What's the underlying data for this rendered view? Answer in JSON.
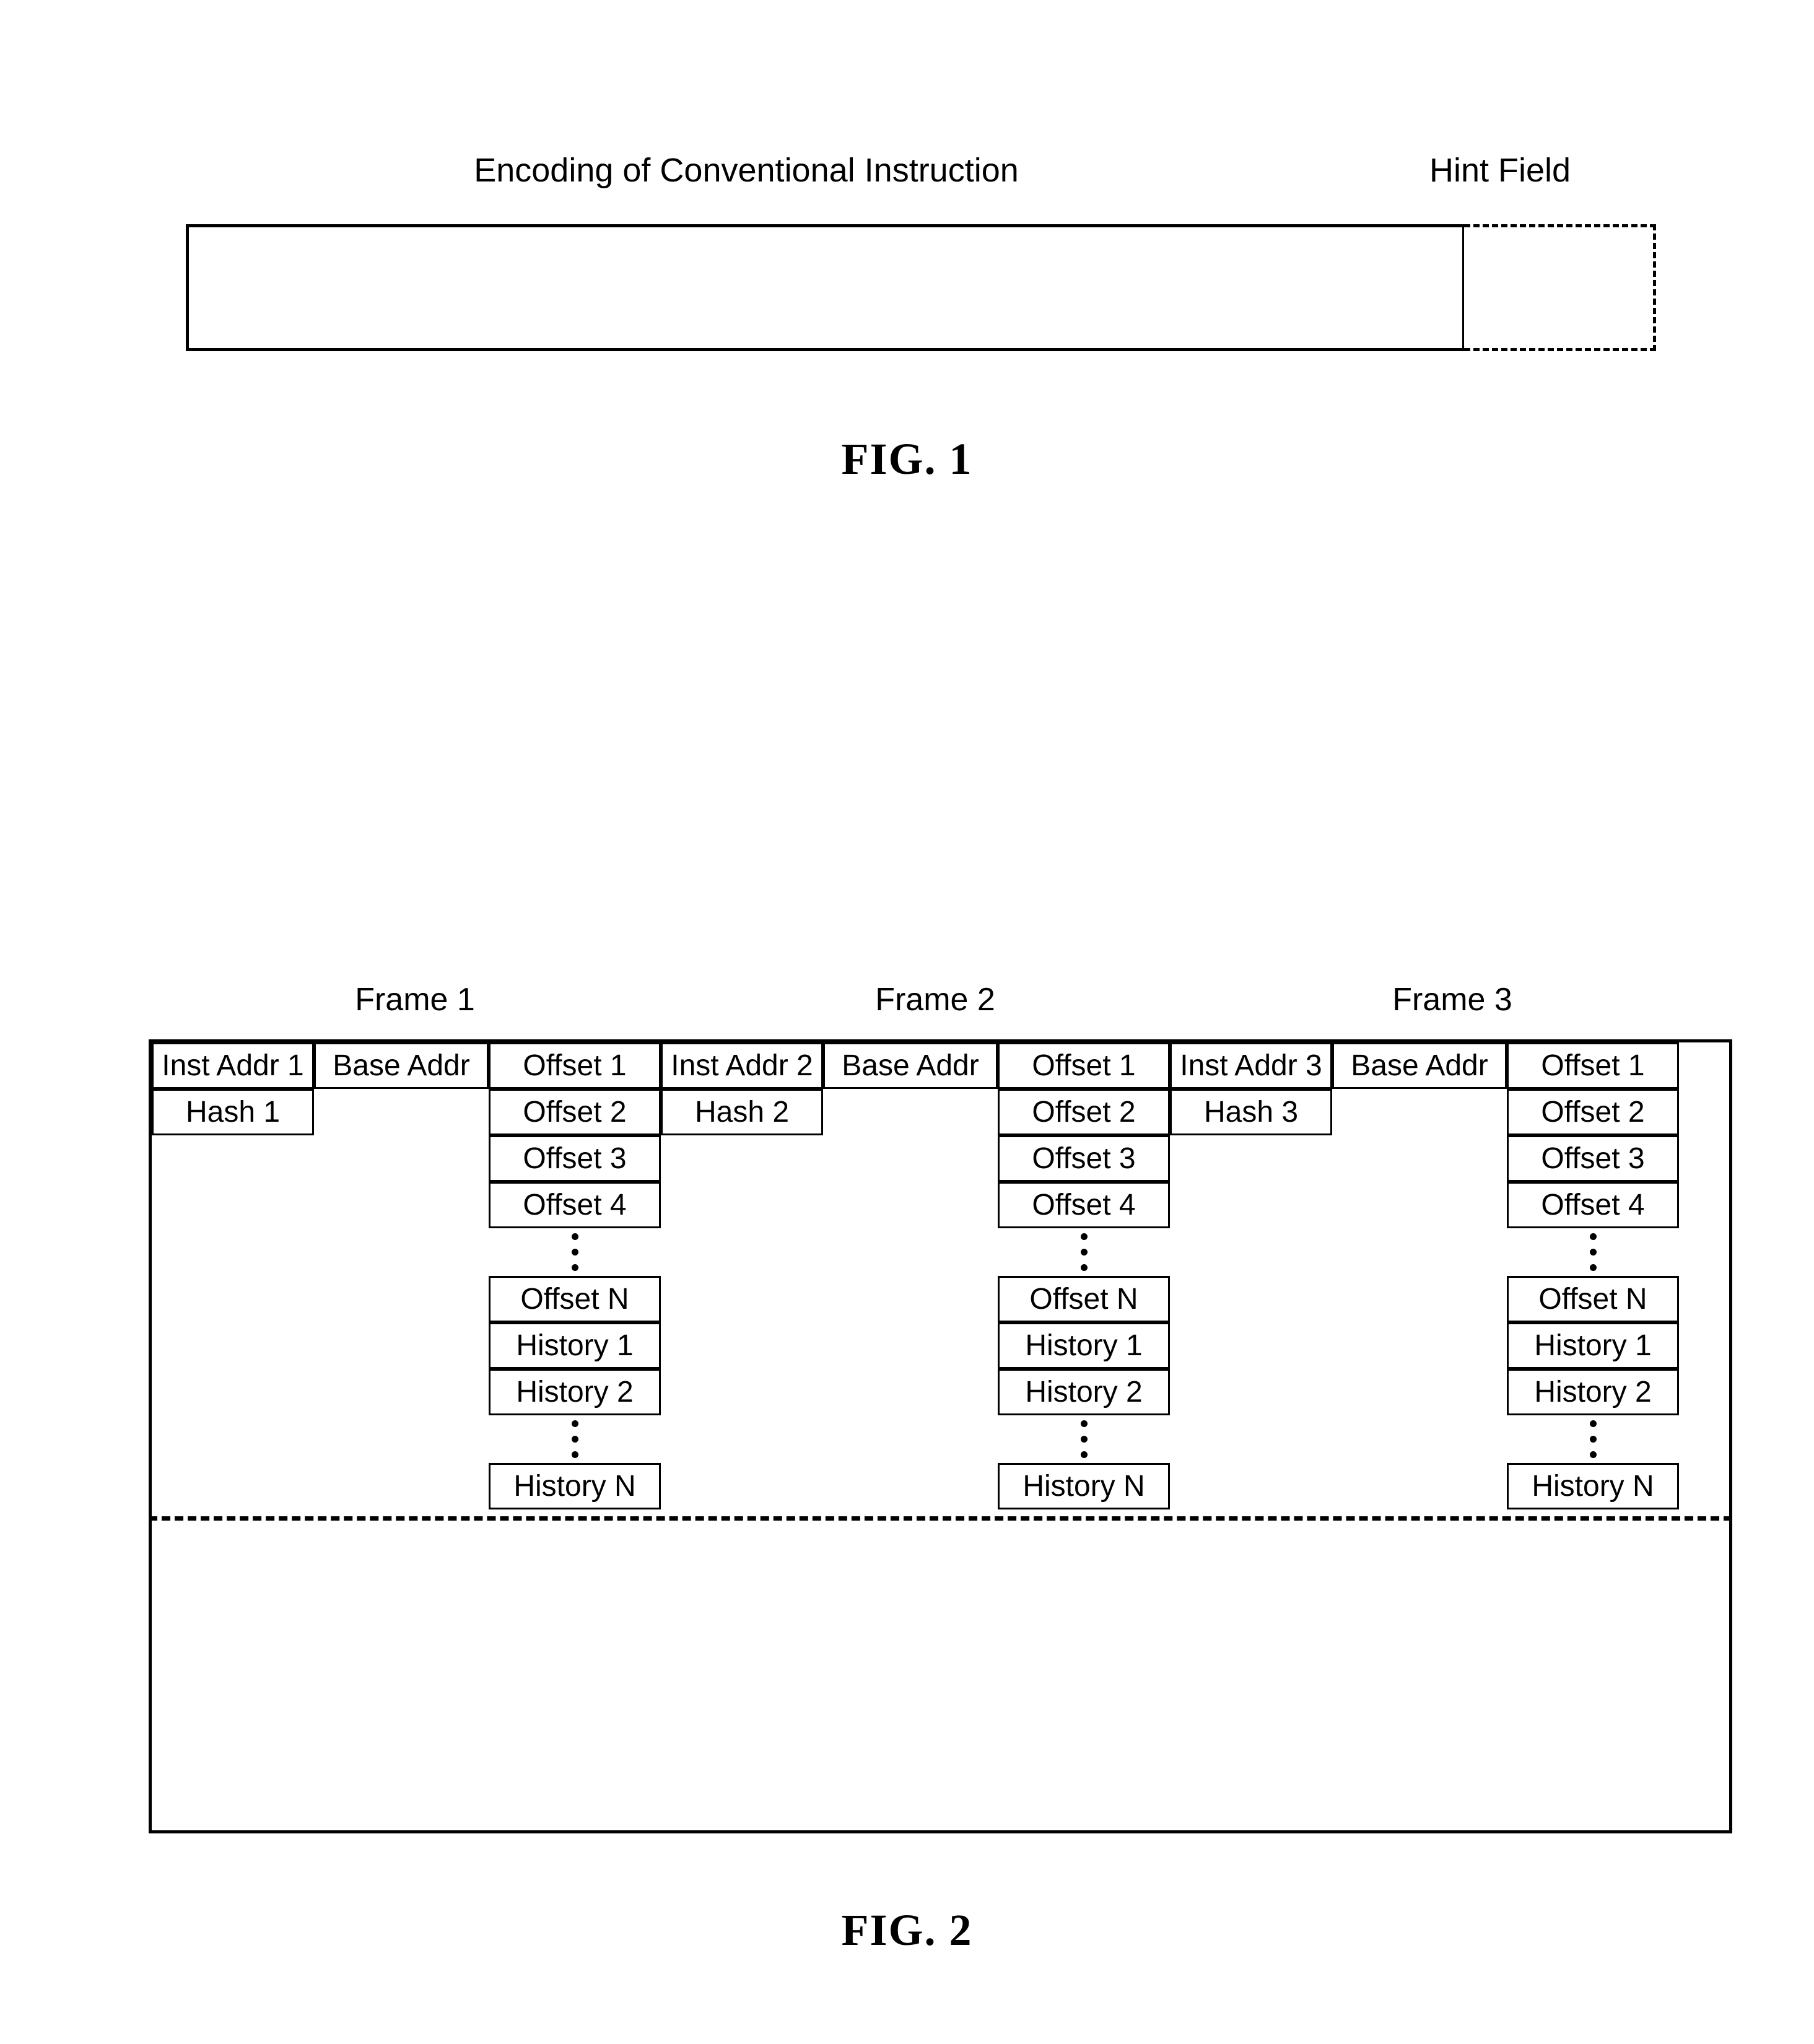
{
  "figure1": {
    "label_encoding": "Encoding of Conventional Instruction",
    "label_hint": "Hint Field",
    "caption": "FIG. 1",
    "bar_fill": "#ffffff",
    "line_color": "#000000"
  },
  "figure2": {
    "caption": "FIG. 2",
    "frames": [
      {
        "header": "Frame 1",
        "inst_addr": "Inst Addr 1",
        "hash": "Hash 1",
        "base_addr": "Base Addr",
        "offsets": [
          "Offset 1",
          "Offset 2",
          "Offset 3",
          "Offset 4"
        ],
        "offset_ellipsis": "⋮",
        "offset_last": "Offset N",
        "histories": [
          "History 1",
          "History 2"
        ],
        "history_ellipsis": "⋮",
        "history_last": "History N"
      },
      {
        "header": "Frame 2",
        "inst_addr": "Inst Addr 2",
        "hash": "Hash 2",
        "base_addr": "Base Addr",
        "offsets": [
          "Offset 1",
          "Offset 2",
          "Offset 3",
          "Offset 4"
        ],
        "offset_ellipsis": "⋮",
        "offset_last": "Offset N",
        "histories": [
          "History 1",
          "History 2"
        ],
        "history_ellipsis": "⋮",
        "history_last": "History N"
      },
      {
        "header": "Frame 3",
        "inst_addr": "Inst Addr 3",
        "hash": "Hash 3",
        "base_addr": "Base Addr",
        "offsets": [
          "Offset 1",
          "Offset 2",
          "Offset 3",
          "Offset 4"
        ],
        "offset_ellipsis": "⋮",
        "offset_last": "Offset N",
        "histories": [
          "History 1",
          "History 2"
        ],
        "history_ellipsis": "⋮",
        "history_last": "History N"
      }
    ],
    "divider_style": "dashed",
    "line_color": "#000000"
  }
}
